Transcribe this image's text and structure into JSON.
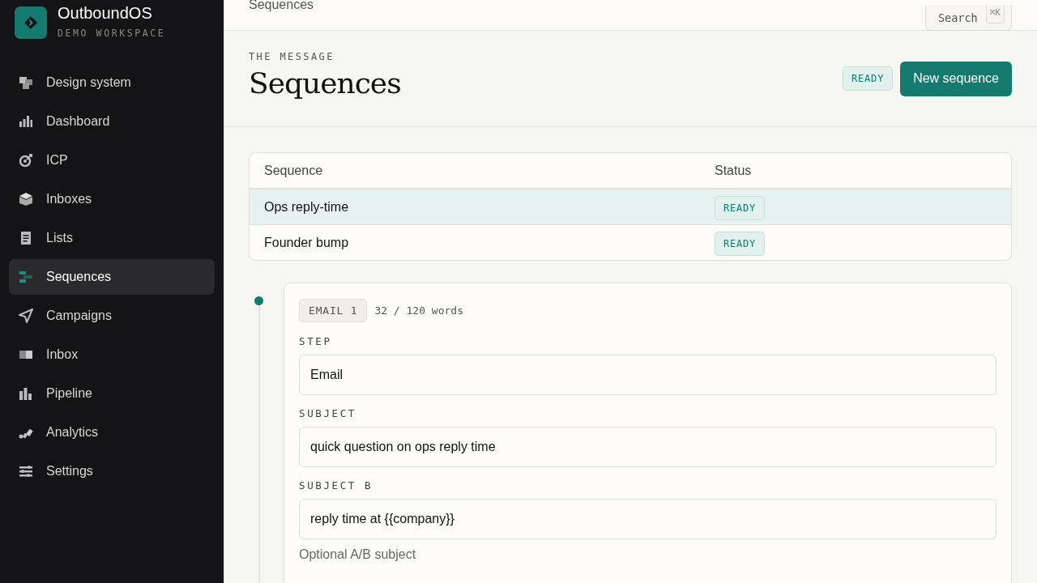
{
  "app": {
    "name": "OutboundOS",
    "workspace": "DEMO WORKSPACE"
  },
  "sidebar": {
    "items": [
      {
        "label": "Design system",
        "selected": false
      },
      {
        "label": "Dashboard",
        "selected": false
      },
      {
        "label": "ICP",
        "selected": false
      },
      {
        "label": "Inboxes",
        "selected": false
      },
      {
        "label": "Lists",
        "selected": false
      },
      {
        "label": "Sequences",
        "selected": true
      },
      {
        "label": "Campaigns",
        "selected": false
      },
      {
        "label": "Inbox",
        "selected": false
      },
      {
        "label": "Pipeline",
        "selected": false
      },
      {
        "label": "Analytics",
        "selected": false
      },
      {
        "label": "Settings",
        "selected": false
      }
    ]
  },
  "topbar": {
    "breadcrumb": "Sequences",
    "search": {
      "label": "Search",
      "shortcut": "⌘K"
    }
  },
  "header": {
    "eyebrow": "THE MESSAGE",
    "title": "Sequences",
    "status": "READY",
    "primary_button": "New sequence"
  },
  "table": {
    "columns": [
      "Sequence",
      "Status"
    ],
    "rows": [
      {
        "sequence": "Ops reply-time",
        "status": "READY",
        "selected": true
      },
      {
        "sequence": "Founder bump",
        "status": "READY",
        "selected": false
      }
    ]
  },
  "steps": [
    {
      "tag": "EMAIL 1",
      "word_count": "32 / 120 words",
      "fields": [
        {
          "label": "STEP",
          "value": "Email"
        },
        {
          "label": "SUBJECT",
          "value": "quick question on ops reply time"
        },
        {
          "label": "SUBJECT B",
          "value": "reply time at {{company}}",
          "hint": "Optional A/B subject"
        }
      ]
    }
  ]
}
